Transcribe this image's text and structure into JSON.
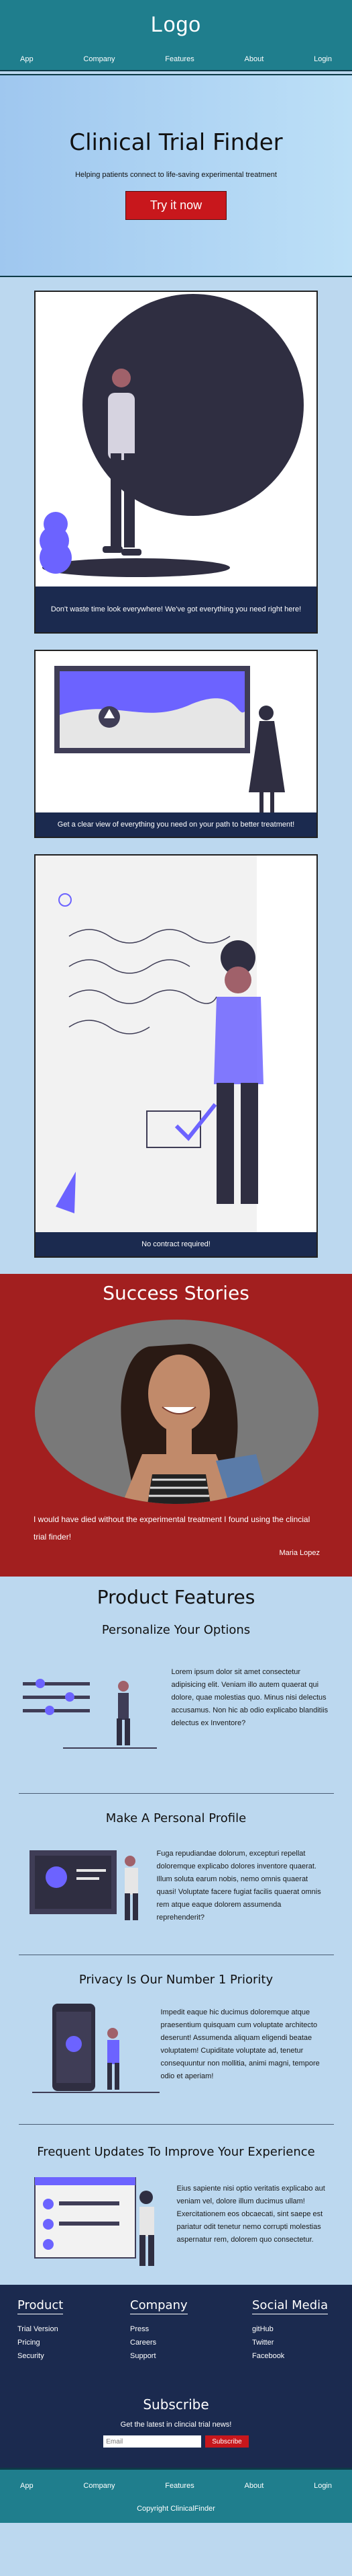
{
  "header": {
    "logo": "Logo",
    "nav": [
      "App",
      "Company",
      "Features",
      "About",
      "Login"
    ]
  },
  "hero": {
    "title": "Clinical Trial Finder",
    "subtitle": "Helping patients connect to life-saving experimental treatment",
    "cta": "Try it now"
  },
  "cards": [
    "Don't waste time look everywhere! We've got everything you need right here!",
    "Get a clear view of everything you need on your path to better treatment!",
    "No contract required!"
  ],
  "success": {
    "title": "Success Stories",
    "quote": "I would have died without the experimental treatment I found using the clincial trial finder!",
    "author": "Maria Lopez"
  },
  "features": {
    "title": "Product Features",
    "items": [
      {
        "title": "Personalize Your Options",
        "text": "Lorem ipsum dolor sit amet consectetur adipisicing elit. Veniam illo autem quaerat qui dolore, quae molestias quo. Minus nisi delectus accusamus. Non hic ab odio explicabo blanditiis delectus ex Inventore?"
      },
      {
        "title": "Make A Personal Profile",
        "text": "Fuga repudiandae dolorum, excepturi repellat doloremque explicabo dolores inventore quaerat. Illum soluta earum nobis, nemo omnis quaerat quasi! Voluptate facere fugiat facilis quaerat omnis rem atque eaque dolorem assumenda reprehenderit?"
      },
      {
        "title": "Privacy Is Our Number 1 Priority",
        "text": "Impedit eaque hic ducimus doloremque atque praesentium quisquam cum voluptate architecto deserunt! Assumenda aliquam eligendi beatae voluptatem! Cupiditate voluptate ad, tenetur consequuntur non mollitia, animi magni, tempore odio et aperiam!"
      },
      {
        "title": "Frequent Updates To Improve Your Experience",
        "text": "Eius sapiente nisi optio veritatis explicabo aut veniam vel, dolore illum ducimus ullam! Exercitationem eos obcaecati, sint saepe est pariatur odit tenetur nemo corrupti molestias aspernatur rem, dolorem quo consectetur."
      }
    ]
  },
  "footer": {
    "product": {
      "title": "Product",
      "links": [
        "Trial Version",
        "Pricing",
        "Security"
      ]
    },
    "company": {
      "title": "Company",
      "links": [
        "Press",
        "Careers",
        "Support"
      ]
    },
    "social": {
      "title": "Social Media",
      "links": [
        "gitHub",
        "Twitter",
        "Facebook"
      ]
    },
    "subscribe": {
      "title": "Subscribe",
      "text": "Get the latest in clincial trial news!",
      "placeholder": "Email",
      "button": "Subscribe"
    },
    "nav": [
      "App",
      "Company",
      "Features",
      "About",
      "Login"
    ],
    "copyright": "Copyright ClinicalFinder"
  },
  "colors": {
    "header_teal": "#1f7e8d",
    "accent_red": "#c8171c",
    "success_red": "#a21f1f",
    "navy": "#1b2a4f",
    "illustration_purple": "#6c63ff",
    "page_blue": "#bcd8ef"
  }
}
